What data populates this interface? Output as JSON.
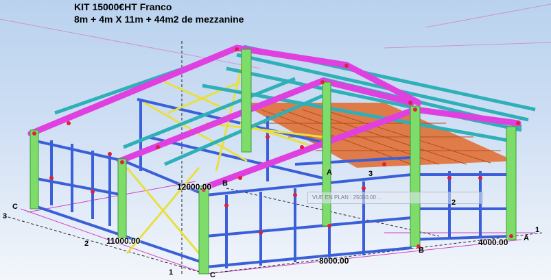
{
  "header": {
    "title_line1": "KIT 15000€HT Franco",
    "title_line2": "8m + 4m X 11m + 44m2 de mezzanine"
  },
  "dimensions": {
    "height": "12000.00",
    "depth": "11000.00",
    "width_main": "8000.00",
    "width_annex": "4000.00"
  },
  "axis_labels": {
    "left_C": "C",
    "left_3": "3",
    "left_2": "2",
    "bottom_1": "1",
    "bottom_C": "C",
    "front_B": "B",
    "ridge_A": "A",
    "ridge_3": "3",
    "right_2": "2",
    "right_B": "B",
    "right_1": "1",
    "right_A": "A"
  },
  "overlay": {
    "plan_label": "VUE EN PLAN : 25000.00  ..."
  },
  "colors": {
    "rafter": "#e040e0",
    "column": "#7edc6a",
    "purlin": "#2fb0b8",
    "girt": "#3a5fd8",
    "brace": "#e8e040",
    "mezzanine": "#e06a2a",
    "node": "#e0203a"
  }
}
